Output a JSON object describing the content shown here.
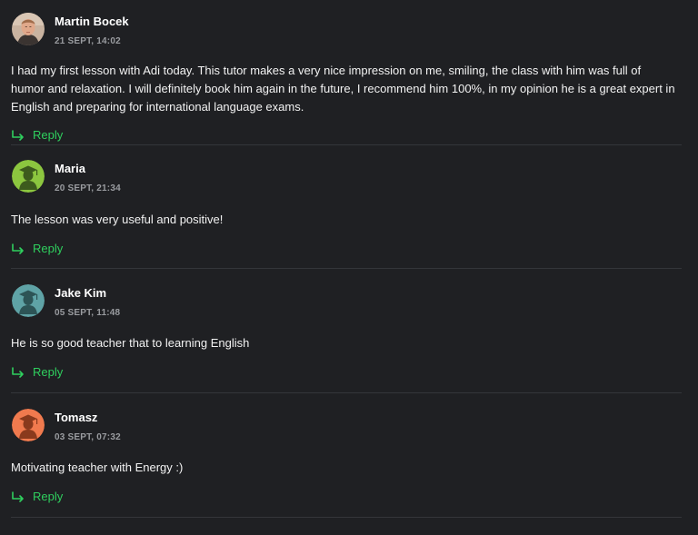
{
  "comments": [
    {
      "author": "Martin Bocek",
      "date": "21 SEPT, 14:02",
      "text": "I had my first lesson with Adi today. This tutor makes a very nice impression on me, smiling, the class with him was full of humor and relaxation. I will definitely book him again in the future, I recommend him 100%, in my opinion he is a great expert in English and preparing for international language exams.",
      "reply_label": "Reply",
      "avatar": "photo-avatar"
    },
    {
      "author": "Maria",
      "date": "20 SEPT, 21:34",
      "text": "The lesson was very useful and positive!",
      "reply_label": "Reply",
      "avatar": "graduate-icon",
      "avatar_color": "#8cc63f"
    },
    {
      "author": "Jake Kim",
      "date": "05 SEPT, 11:48",
      "text": "He is so good teacher that to learning English",
      "reply_label": "Reply",
      "avatar": "graduate-icon",
      "avatar_color": "#5fa3a6"
    },
    {
      "author": "Tomasz",
      "date": "03 SEPT, 07:32",
      "text": "Motivating teacher with Energy :)",
      "reply_label": "Reply",
      "avatar": "graduate-icon",
      "avatar_color": "#f07a4e"
    }
  ],
  "colors": {
    "background": "#1f2023",
    "reply": "#2fcf5e",
    "divider": "#34363a"
  }
}
